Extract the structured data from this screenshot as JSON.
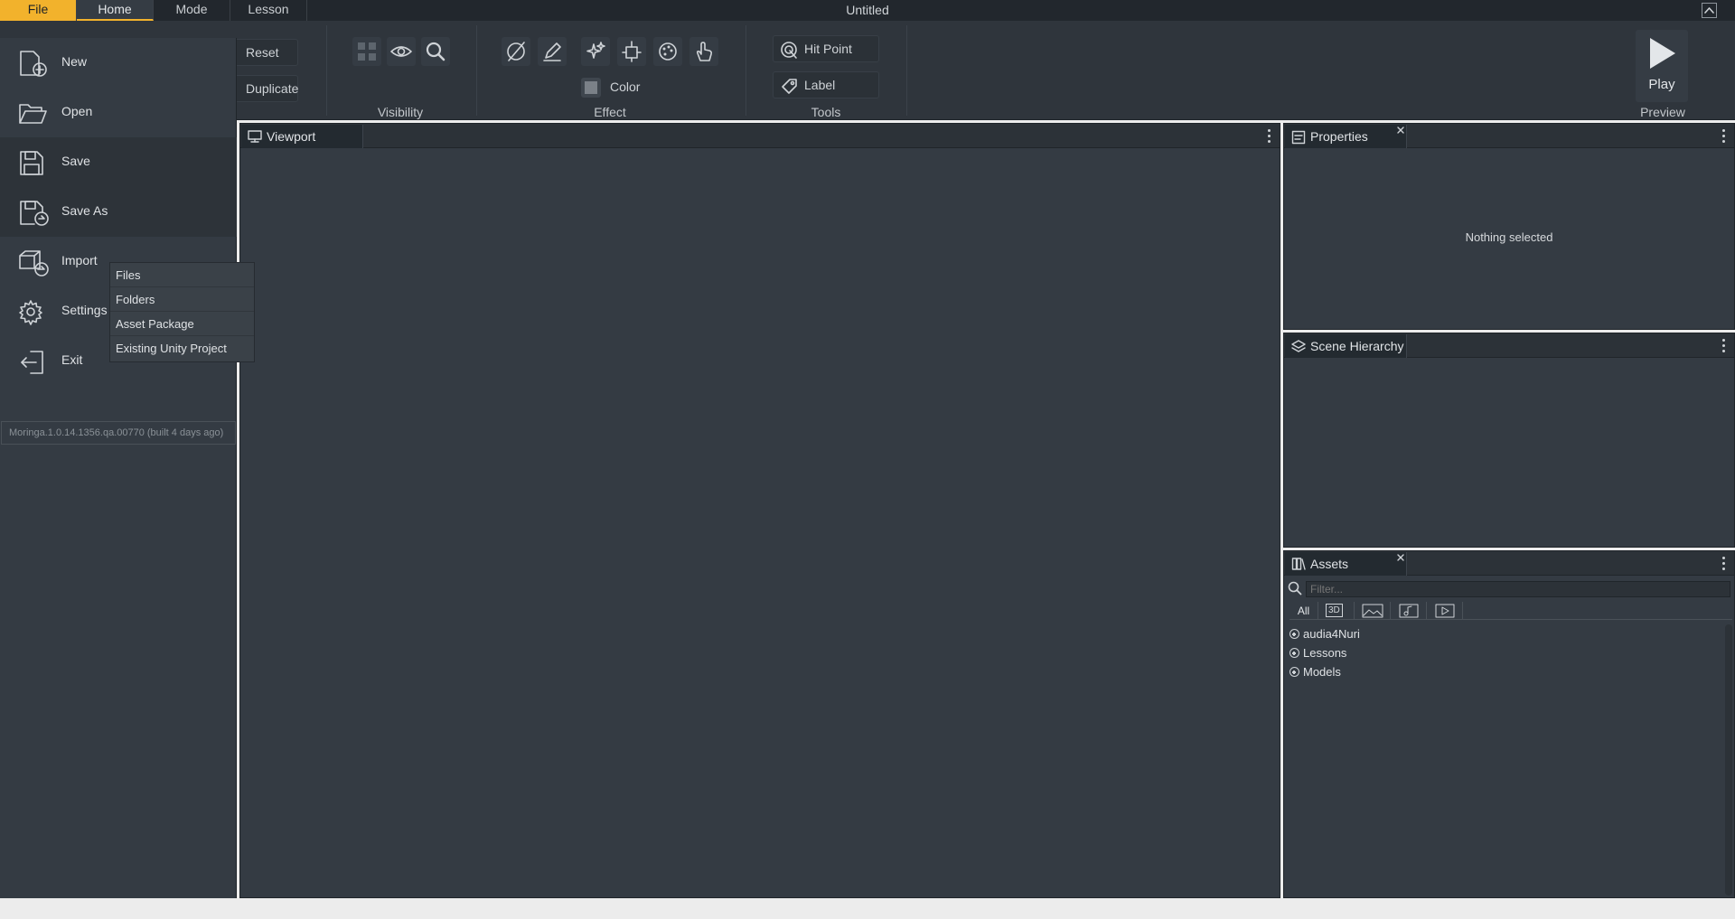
{
  "app": {
    "title": "Untitled",
    "tabs": [
      "File",
      "Home",
      "Mode",
      "Lesson"
    ],
    "active_tab": "Home"
  },
  "ribbon": {
    "edit": {
      "reset": "Reset",
      "duplicate": "Duplicate"
    },
    "visibility": {
      "label": "Visibility",
      "icons": [
        "grid-icon",
        "eye-icon",
        "search-icon"
      ]
    },
    "effect": {
      "label": "Effect",
      "icons": [
        "no-draw-icon",
        "pen-icon",
        "sparkle-icon",
        "cube-transform-icon",
        "palette-icon",
        "hand-icon"
      ],
      "color_label": "Color"
    },
    "tools": {
      "label": "Tools",
      "hit_point": "Hit Point",
      "label_btn": "Label"
    },
    "preview": {
      "label": "Preview",
      "play": "Play"
    }
  },
  "file_menu": {
    "items": [
      {
        "label": "New",
        "icon": "new-file-icon"
      },
      {
        "label": "Open",
        "icon": "folder-open-icon"
      },
      {
        "label": "Save",
        "icon": "save-icon"
      },
      {
        "label": "Save As",
        "icon": "save-as-icon"
      },
      {
        "label": "Import",
        "icon": "import-icon"
      },
      {
        "label": "Settings",
        "icon": "gear-icon"
      },
      {
        "label": "Exit",
        "icon": "exit-icon"
      }
    ],
    "version": "Moringa.1.0.14.1356.qa.00770 (built 4 days ago)",
    "import_submenu": [
      "Files",
      "Folders",
      "Asset Package",
      "Existing Unity Project"
    ]
  },
  "viewport": {
    "title": "Viewport"
  },
  "properties": {
    "title": "Properties",
    "empty_text": "Nothing selected"
  },
  "scene_hierarchy": {
    "title": "Scene Hierarchy"
  },
  "assets": {
    "title": "Assets",
    "filter_placeholder": "Filter...",
    "type_tabs": [
      "All",
      "3D"
    ],
    "tree": [
      "audia4Nuri",
      "Lessons",
      "Models"
    ]
  },
  "colors": {
    "accent": "#f2b22c",
    "background": "#343b43",
    "panel_header": "#2c3238"
  }
}
